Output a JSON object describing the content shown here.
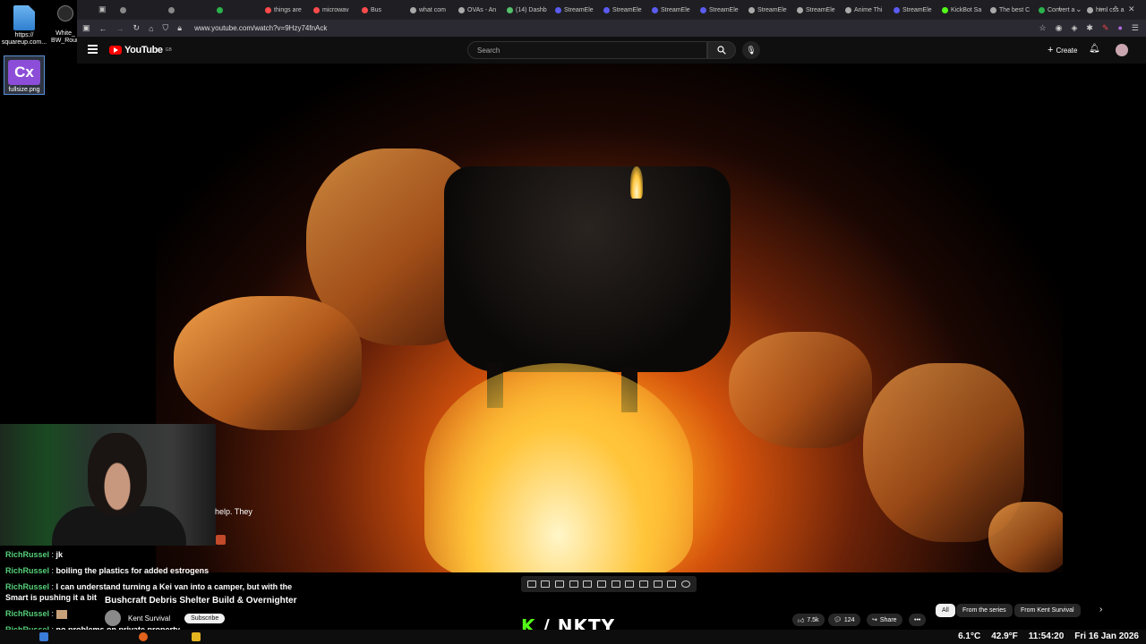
{
  "desktop": {
    "icons": [
      {
        "label": "https://\nsquareup.com..."
      },
      {
        "label": "White_\nBW_Roun"
      },
      {
        "label": "fullsize.png",
        "logo": "Cx"
      }
    ]
  },
  "browser": {
    "tabs": [
      {
        "label": "",
        "color": "#888888"
      },
      {
        "label": "",
        "color": "#888888"
      },
      {
        "label": "",
        "color": "#2bb24c"
      },
      {
        "label": "things are",
        "color": "#ff4b4b"
      },
      {
        "label": "microwav",
        "color": "#ff4b4b"
      },
      {
        "label": "Bus",
        "color": "#ff4b4b"
      },
      {
        "label": "what com",
        "color": "#aaaaaa"
      },
      {
        "label": "OVAs - An",
        "color": "#aaaaaa"
      },
      {
        "label": "(14) Dashb",
        "color": "#53c26b"
      },
      {
        "label": "StreamEle",
        "color": "#5b5bf0"
      },
      {
        "label": "StreamEle",
        "color": "#5b5bf0"
      },
      {
        "label": "StreamEle",
        "color": "#5b5bf0"
      },
      {
        "label": "StreamEle",
        "color": "#5b5bf0"
      },
      {
        "label": "StreamEle",
        "color": "#aaaaaa"
      },
      {
        "label": "StreamEle",
        "color": "#aaaaaa"
      },
      {
        "label": "Anime Thi",
        "color": "#aaaaaa"
      },
      {
        "label": "StreamEle",
        "color": "#5b5bf0"
      },
      {
        "label": "KickBot Sa",
        "color": "#53fc18"
      },
      {
        "label": "The best C",
        "color": "#aaaaaa"
      },
      {
        "label": "Convert a",
        "color": "#2bb24c"
      },
      {
        "label": "html css a",
        "color": "#aaaaaa"
      }
    ],
    "url": "www.youtube.com/watch?v=9Hzy74fnAck"
  },
  "youtube": {
    "logo_text": "YouTube",
    "region": "GB",
    "search_placeholder": "Search",
    "create_label": "Create",
    "video_title": "Bushcraft Debris Shelter Build & Overnighter",
    "channel_name": "Kent Survival",
    "subscribe_label": "Subscribe",
    "likes": "7.5k",
    "comments": "124",
    "share_label": "Share",
    "chips": [
      "All",
      "From the series",
      "From Kent Survival"
    ]
  },
  "stream": {
    "peek_text": "help. They",
    "brand_k": "K",
    "brand_rest": "/ NKTY",
    "chat": [
      {
        "user": "RichRussel",
        "msg": "jk"
      },
      {
        "user": "RichRussel",
        "msg": "boiling the plastics for added estrogens"
      },
      {
        "user": "RichRussel",
        "msg": "I can understand turning a Kei van into a camper, but with the Smart is pushing it a bit"
      },
      {
        "user": "RichRussel",
        "msg": ""
      },
      {
        "user": "RichRussel",
        "msg": "no problems on private property."
      }
    ]
  },
  "tray": {
    "temperature": "6.1°C",
    "humidity": "42.9°F",
    "time": "11:54:20",
    "date": "Fri 16 Jan 2026"
  }
}
